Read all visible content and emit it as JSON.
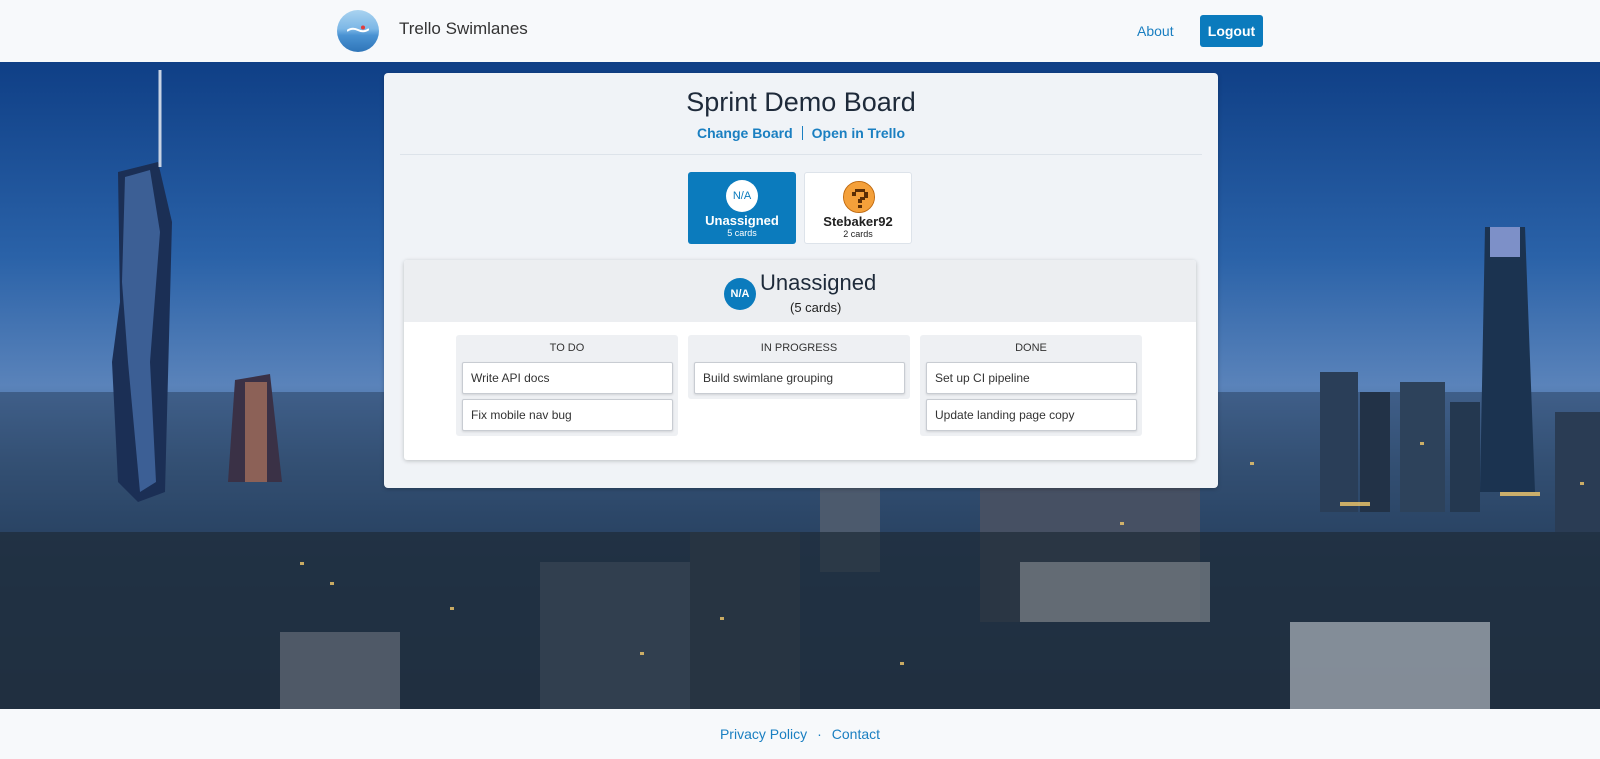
{
  "header": {
    "app_title": "Trello Swimlanes",
    "about_label": "About",
    "logout_label": "Logout"
  },
  "board": {
    "title": "Sprint Demo Board",
    "change_board_label": "Change Board",
    "open_in_trello_label": "Open in Trello"
  },
  "members": [
    {
      "avatar_text": "N/A",
      "name": "Unassigned",
      "count": "5 cards",
      "selected": true
    },
    {
      "avatar_icon": "question-block-icon",
      "name": "Stebaker92",
      "count": "2 cards",
      "selected": false
    }
  ],
  "swimlane": {
    "avatar_text": "N/A",
    "title": "Unassigned",
    "count": "(5 cards)",
    "columns": [
      {
        "title": "TO DO",
        "cards": [
          "Write API docs",
          "Fix mobile nav bug"
        ]
      },
      {
        "title": "IN PROGRESS",
        "cards": [
          "Build swimlane grouping"
        ]
      },
      {
        "title": "DONE",
        "cards": [
          "Set up CI pipeline",
          "Update landing page copy"
        ]
      }
    ]
  },
  "footer": {
    "privacy_label": "Privacy Policy",
    "separator": "·",
    "contact_label": "Contact"
  },
  "colors": {
    "primary": "#0b7bbd",
    "link": "#1a7fc1",
    "panel_bg": "#f0f3f7"
  }
}
